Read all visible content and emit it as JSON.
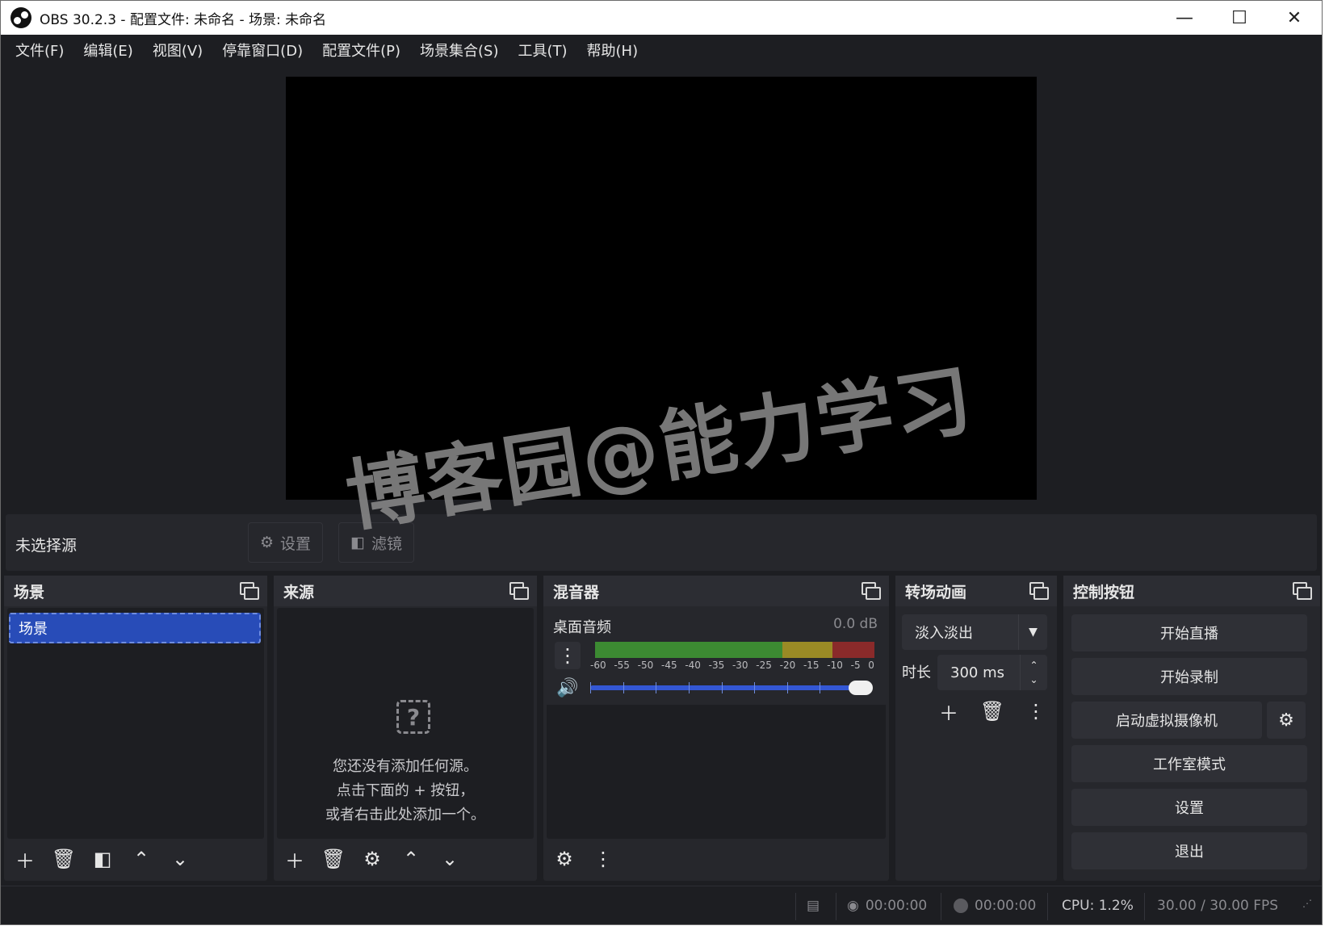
{
  "window": {
    "title": "OBS 30.2.3 - 配置文件: 未命名 - 场景: 未命名"
  },
  "menu": [
    "文件(F)",
    "编辑(E)",
    "视图(V)",
    "停靠窗口(D)",
    "配置文件(P)",
    "场景集合(S)",
    "工具(T)",
    "帮助(H)"
  ],
  "source_toolbar": {
    "no_source": "未选择源",
    "settings_label": "设置",
    "filters_label": "滤镜"
  },
  "scenes": {
    "title": "场景",
    "items": [
      "场景"
    ]
  },
  "sources": {
    "title": "来源",
    "empty_lines": [
      "您还没有添加任何源。",
      "点击下面的 + 按钮，",
      "或者右击此处添加一个。"
    ]
  },
  "mixer": {
    "title": "混音器",
    "channel_name": "桌面音频",
    "level": "0.0 dB",
    "ticks": [
      "-60",
      "-55",
      "-50",
      "-45",
      "-40",
      "-35",
      "-30",
      "-25",
      "-20",
      "-15",
      "-10",
      "-5",
      "0"
    ],
    "volume": 1.0
  },
  "transitions": {
    "title": "转场动画",
    "selected": "淡入淡出",
    "duration_label": "时长",
    "duration_value": "300 ms"
  },
  "controls": {
    "title": "控制按钮",
    "buttons": [
      "开始直播",
      "开始录制",
      "启动虚拟摄像机",
      "工作室模式",
      "设置",
      "退出"
    ]
  },
  "status": {
    "stream_time": "00:00:00",
    "record_time": "00:00:00",
    "cpu": "CPU: 1.2%",
    "fps": "30.00 / 30.00 FPS"
  },
  "watermark": "博客园@能力学习",
  "colors": {
    "background": "#1d1e22",
    "panel": "#26272c",
    "accent": "#284cb8",
    "meter_green": "#3c8a32",
    "meter_yellow": "#9a8a25",
    "meter_red": "#8a2a2a"
  }
}
